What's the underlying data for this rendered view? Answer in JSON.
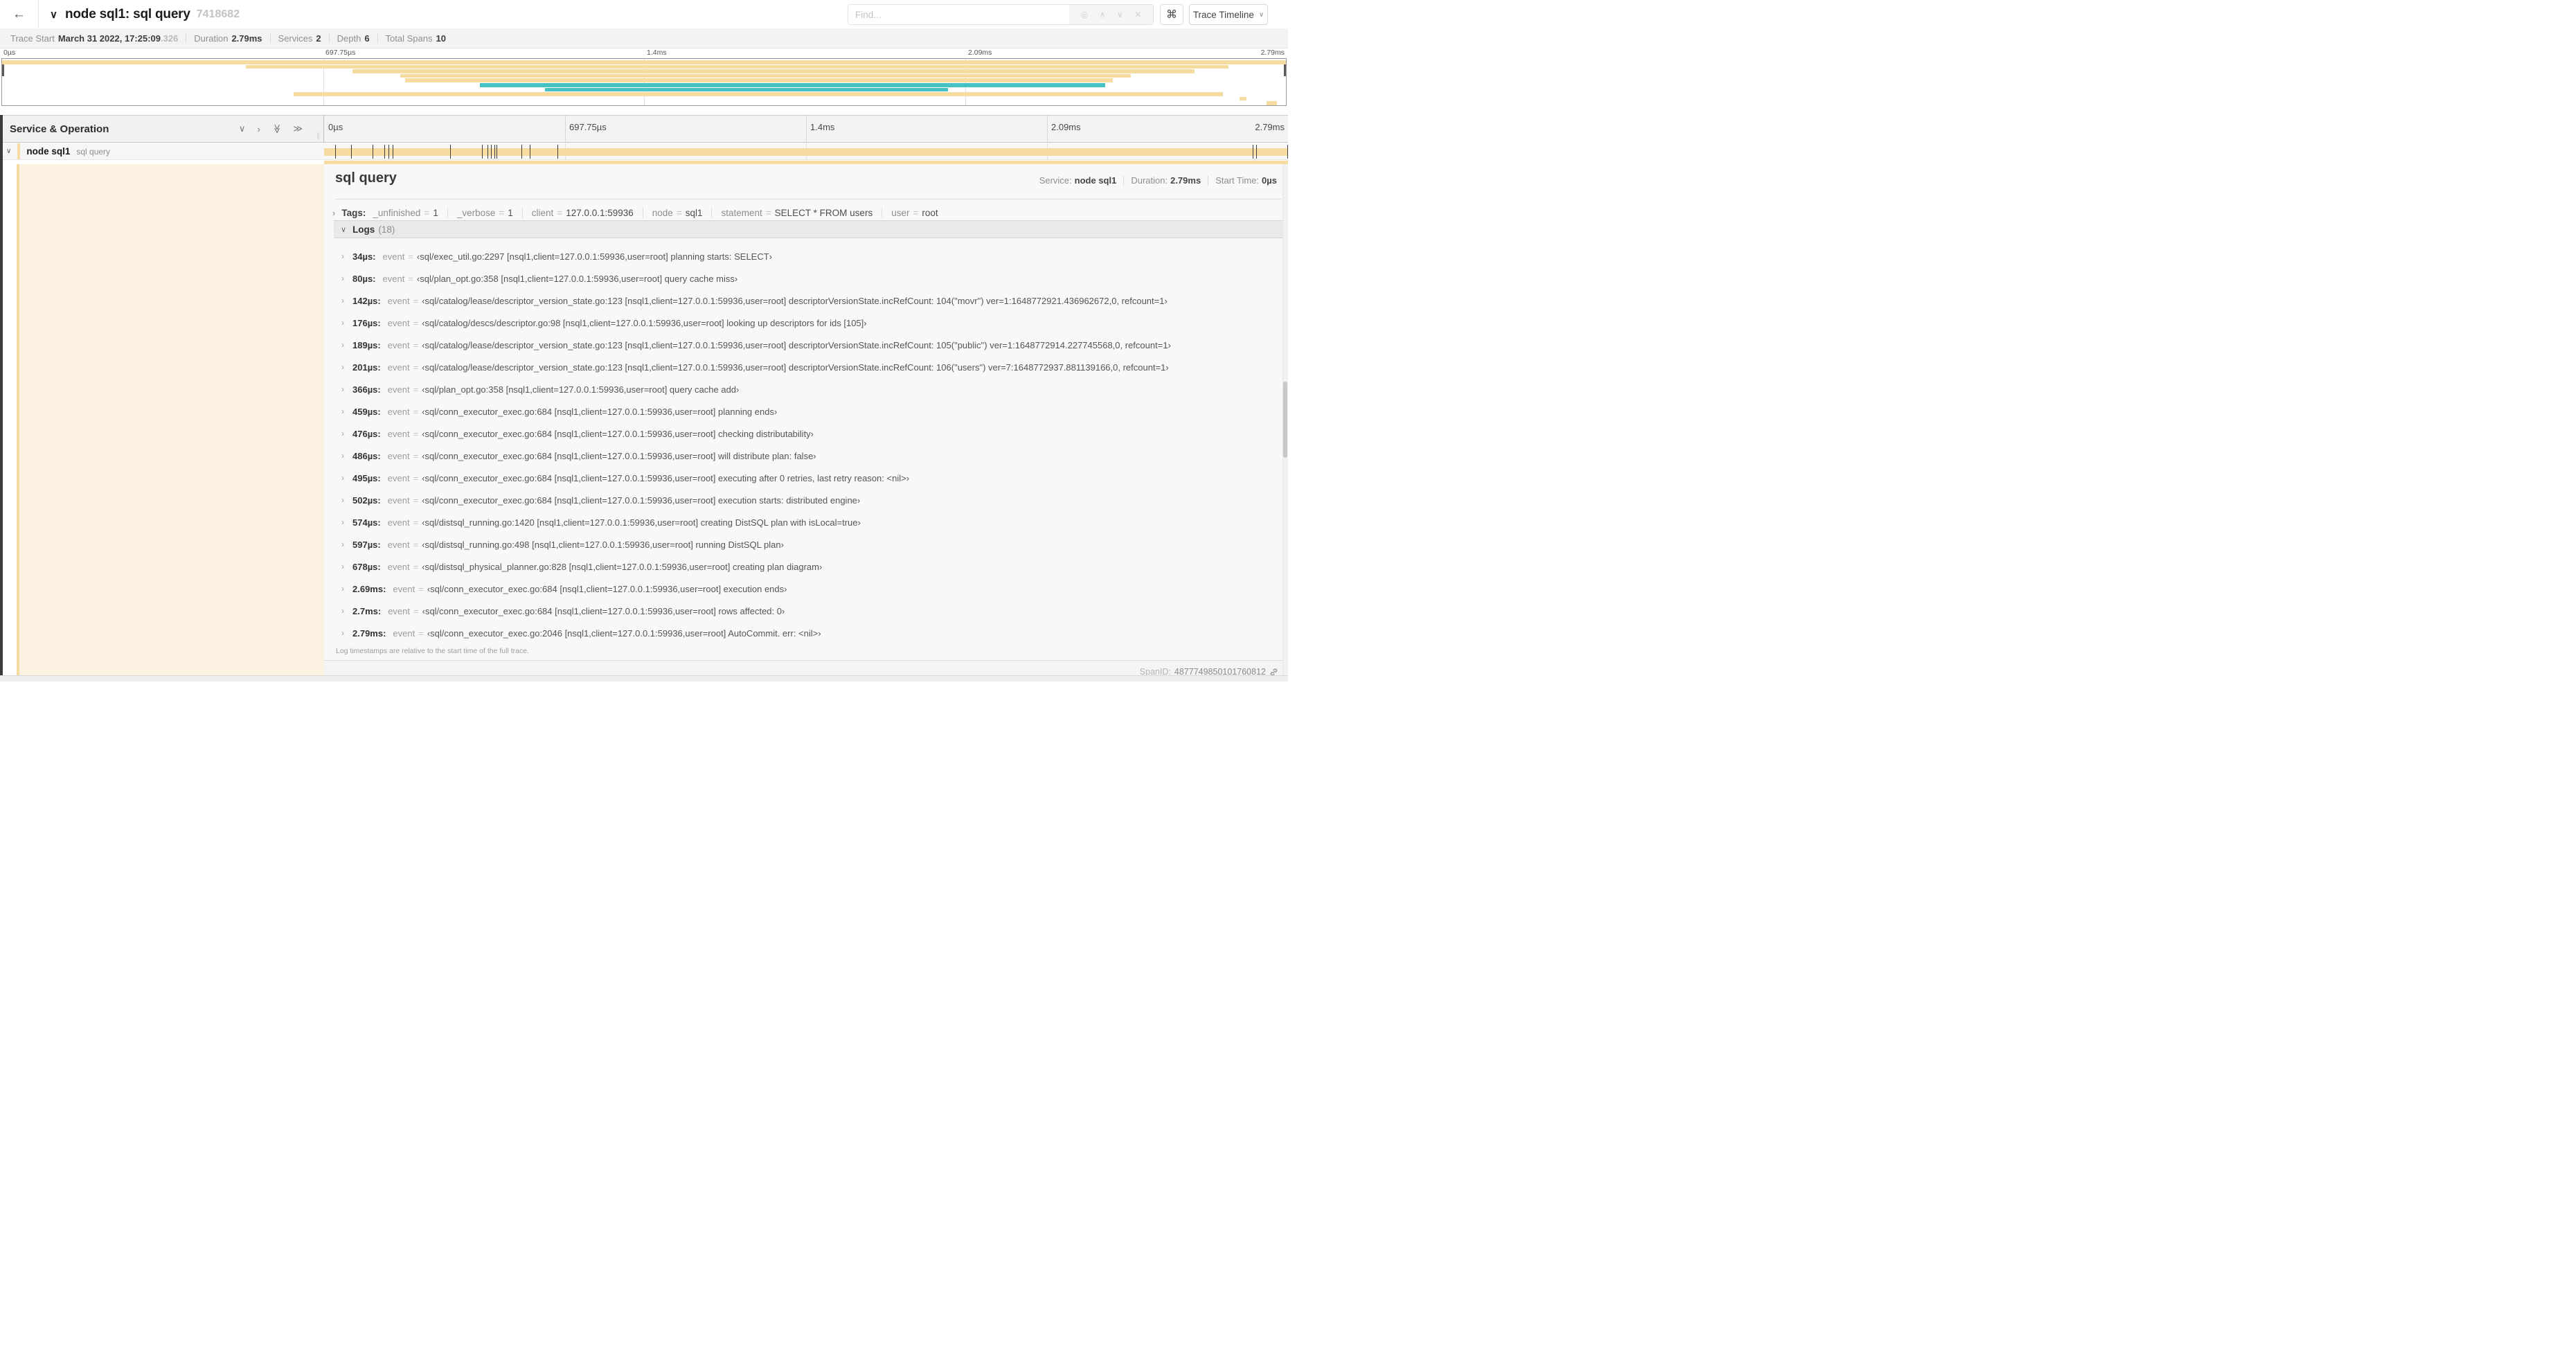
{
  "header": {
    "back_icon": "←",
    "collapse_icon": "∨",
    "title": "node sql1: sql query",
    "trace_id": "7418682",
    "search": {
      "placeholder": "Find...",
      "locate_icon": "◎",
      "prev_icon": "∧",
      "next_icon": "∨",
      "clear_icon": "✕"
    },
    "shortcuts_button": "⌘",
    "view_selector": {
      "label": "Trace Timeline",
      "caret": "∨"
    }
  },
  "trace_info": {
    "items": [
      {
        "label": "Trace Start",
        "value": "March 31 2022, 17:25:09",
        "value_muted": ".326"
      },
      {
        "label": "Duration",
        "value": "2.79ms"
      },
      {
        "label": "Services",
        "value": "2"
      },
      {
        "label": "Depth",
        "value": "6"
      },
      {
        "label": "Total Spans",
        "value": "10"
      }
    ]
  },
  "minimap": {
    "axis_labels": [
      "0µs",
      "697.75µs",
      "1.4ms",
      "2.09ms",
      "2.79ms"
    ],
    "spans": [
      {
        "start": 0.0,
        "end": 1.0,
        "color": "#f7dca1"
      },
      {
        "start": 0.19,
        "end": 0.955,
        "color": "#f7dca1"
      },
      {
        "start": 0.273,
        "end": 0.929,
        "color": "#f7dca1"
      },
      {
        "start": 0.31,
        "end": 0.879,
        "color": "#f7dca1"
      },
      {
        "start": 0.314,
        "end": 0.865,
        "color": "#f7dca1"
      },
      {
        "start": 0.372,
        "end": 0.859,
        "color": "#46c2c2"
      },
      {
        "start": 0.423,
        "end": 0.737,
        "color": "#46c2c2"
      },
      {
        "start": 0.227,
        "end": 0.951,
        "color": "#f7dca1"
      },
      {
        "start": 0.964,
        "end": 0.969,
        "color": "#f7dca1"
      },
      {
        "start": 0.985,
        "end": 0.993,
        "color": "#f7dca1"
      }
    ]
  },
  "timeline": {
    "left_header": "Service & Operation",
    "header_icons": {
      "collapse_one": "∨",
      "expand_one": "›",
      "collapse_all": "≫",
      "expand_all": "≫"
    },
    "ruler_labels": [
      "0µs",
      "697.75µs",
      "1.4ms",
      "2.09ms",
      "2.79ms"
    ],
    "duration_us": 2790,
    "row": {
      "caret": "∨",
      "service": "node sql1",
      "operation": "sql query"
    }
  },
  "detail": {
    "title": "sql query",
    "meta": [
      {
        "label": "Service:",
        "value": "node sql1"
      },
      {
        "label": "Duration:",
        "value": "2.79ms"
      },
      {
        "label": "Start Time:",
        "value": "0µs"
      }
    ],
    "tags": {
      "caret": "›",
      "label": "Tags:",
      "items": [
        {
          "key": "_unfinished",
          "value": "1"
        },
        {
          "key": "_verbose",
          "value": "1"
        },
        {
          "key": "client",
          "value": "127.0.0.1:59936"
        },
        {
          "key": "node",
          "value": "sql1"
        },
        {
          "key": "statement",
          "value": "SELECT * FROM users"
        },
        {
          "key": "user",
          "value": "root"
        }
      ]
    },
    "logs": {
      "caret": "∨",
      "label": "Logs",
      "count": "(18)",
      "entries": [
        {
          "time": "34µs:",
          "key": "event",
          "value": "‹sql/exec_util.go:2297 [nsql1,client=127.0.0.1:59936,user=root] planning starts: SELECT›"
        },
        {
          "time": "80µs:",
          "key": "event",
          "value": "‹sql/plan_opt.go:358 [nsql1,client=127.0.0.1:59936,user=root] query cache miss›"
        },
        {
          "time": "142µs:",
          "key": "event",
          "value": "‹sql/catalog/lease/descriptor_version_state.go:123 [nsql1,client=127.0.0.1:59936,user=root] descriptorVersionState.incRefCount: 104(\"movr\") ver=1:1648772921.436962672,0, refcount=1›"
        },
        {
          "time": "176µs:",
          "key": "event",
          "value": "‹sql/catalog/descs/descriptor.go:98 [nsql1,client=127.0.0.1:59936,user=root] looking up descriptors for ids [105]›"
        },
        {
          "time": "189µs:",
          "key": "event",
          "value": "‹sql/catalog/lease/descriptor_version_state.go:123 [nsql1,client=127.0.0.1:59936,user=root] descriptorVersionState.incRefCount: 105(\"public\") ver=1:1648772914.227745568,0, refcount=1›"
        },
        {
          "time": "201µs:",
          "key": "event",
          "value": "‹sql/catalog/lease/descriptor_version_state.go:123 [nsql1,client=127.0.0.1:59936,user=root] descriptorVersionState.incRefCount: 106(\"users\") ver=7:1648772937.881139166,0, refcount=1›"
        },
        {
          "time": "366µs:",
          "key": "event",
          "value": "‹sql/plan_opt.go:358 [nsql1,client=127.0.0.1:59936,user=root] query cache add›"
        },
        {
          "time": "459µs:",
          "key": "event",
          "value": "‹sql/conn_executor_exec.go:684 [nsql1,client=127.0.0.1:59936,user=root] planning ends›"
        },
        {
          "time": "476µs:",
          "key": "event",
          "value": "‹sql/conn_executor_exec.go:684 [nsql1,client=127.0.0.1:59936,user=root] checking distributability›"
        },
        {
          "time": "486µs:",
          "key": "event",
          "value": "‹sql/conn_executor_exec.go:684 [nsql1,client=127.0.0.1:59936,user=root] will distribute plan: false›"
        },
        {
          "time": "495µs:",
          "key": "event",
          "value": "‹sql/conn_executor_exec.go:684 [nsql1,client=127.0.0.1:59936,user=root] executing after 0 retries, last retry reason: <nil>›"
        },
        {
          "time": "502µs:",
          "key": "event",
          "value": "‹sql/conn_executor_exec.go:684 [nsql1,client=127.0.0.1:59936,user=root] execution starts: distributed engine›"
        },
        {
          "time": "574µs:",
          "key": "event",
          "value": "‹sql/distsql_running.go:1420 [nsql1,client=127.0.0.1:59936,user=root] creating DistSQL plan with isLocal=true›"
        },
        {
          "time": "597µs:",
          "key": "event",
          "value": "‹sql/distsql_running.go:498 [nsql1,client=127.0.0.1:59936,user=root] running DistSQL plan›"
        },
        {
          "time": "678µs:",
          "key": "event",
          "value": "‹sql/distsql_physical_planner.go:828 [nsql1,client=127.0.0.1:59936,user=root] creating plan diagram›"
        },
        {
          "time": "2.69ms:",
          "key": "event",
          "value": "‹sql/conn_executor_exec.go:684 [nsql1,client=127.0.0.1:59936,user=root] execution ends›"
        },
        {
          "time": "2.7ms:",
          "key": "event",
          "value": "‹sql/conn_executor_exec.go:684 [nsql1,client=127.0.0.1:59936,user=root] rows affected: 0›"
        },
        {
          "time": "2.79ms:",
          "key": "event",
          "value": "‹sql/conn_executor_exec.go:2046 [nsql1,client=127.0.0.1:59936,user=root] AutoCommit. err: <nil>›"
        }
      ]
    },
    "footer_note": "Log timestamps are relative to the start time of the full trace.",
    "span_id_label": "SpanID:",
    "span_id": "4877749850101760812"
  }
}
